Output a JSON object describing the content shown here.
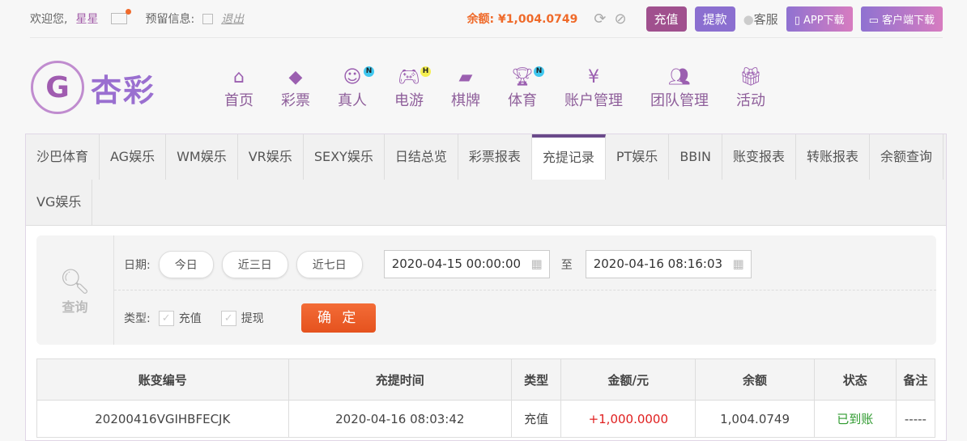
{
  "topbar": {
    "welcome": "欢迎您,",
    "username": "星星",
    "reserved_info": "预留信息:",
    "logout": "退出",
    "balance_label": "余额:",
    "balance": "¥1,004.0749",
    "deposit": "充值",
    "withdraw": "提款",
    "service": "客服",
    "app_download": "APP下载",
    "client_download": "客户端下载"
  },
  "logo": {
    "text": "杏彩"
  },
  "nav": [
    {
      "label": "首页",
      "icon": "home-icon"
    },
    {
      "label": "彩票",
      "icon": "ticket-icon"
    },
    {
      "label": "真人",
      "icon": "woman-icon",
      "badge": "N"
    },
    {
      "label": "电游",
      "icon": "gamepad-icon",
      "badge": "H"
    },
    {
      "label": "棋牌",
      "icon": "cards-icon"
    },
    {
      "label": "体育",
      "icon": "trophy-icon",
      "badge": "N"
    },
    {
      "label": "账户管理",
      "icon": "yen-icon"
    },
    {
      "label": "团队管理",
      "icon": "team-icon"
    },
    {
      "label": "活动",
      "icon": "gift-icon"
    }
  ],
  "tabs": [
    "沙巴体育",
    "AG娱乐",
    "WM娱乐",
    "VR娱乐",
    "SEXY娱乐",
    "日结总览",
    "彩票报表",
    "充提记录",
    "PT娱乐",
    "BBIN",
    "账变报表",
    "转账报表",
    "余额查询",
    "VG娱乐"
  ],
  "active_tab": "充提记录",
  "filter": {
    "query": "查询",
    "date_label": "日期:",
    "today": "今日",
    "three_days": "近三日",
    "seven_days": "近七日",
    "start": "2020-04-15 00:00:00",
    "to": "至",
    "end": "2020-04-16 08:16:03",
    "type_label": "类型:",
    "deposit": "充值",
    "withdraw": "提现",
    "confirm": "确 定"
  },
  "table": {
    "headers": [
      "账变编号",
      "充提时间",
      "类型",
      "金额/元",
      "余额",
      "状态",
      "备注"
    ],
    "rows": [
      [
        "20200416VGIHBFECJK",
        "2020-04-16 08:03:42",
        "充值",
        "+1,000.0000",
        "1,004.0749",
        "已到账",
        "-----"
      ]
    ]
  },
  "colors": {
    "accent": "#a25ca8",
    "balance": "#ef6a2a",
    "amount": "#e02020",
    "status_ok": "#2e9a2e"
  }
}
